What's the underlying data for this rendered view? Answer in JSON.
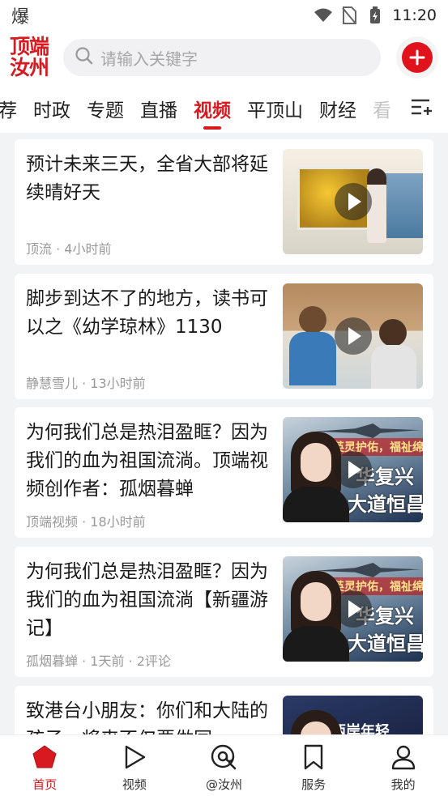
{
  "status_bar": {
    "left_text": "爆",
    "time": "11:20",
    "icons": [
      "wifi-icon",
      "no-sim-icon",
      "battery-charging-icon"
    ]
  },
  "header": {
    "logo_line1": "顶端",
    "logo_line2": "汝州",
    "search_placeholder": "请输入关键字",
    "add_icon": "plus-icon"
  },
  "tabs": {
    "items": [
      "荐",
      "时政",
      "专题",
      "直播",
      "视频",
      "平顶山",
      "财经",
      "看"
    ],
    "active": "视频",
    "menu_icon": "channel-menu-icon"
  },
  "feed": [
    {
      "title": "预计未来三天，全省大部将延续晴好天",
      "meta": "顶流 · 4小时前",
      "thumb": "weather-forecast-thumbnail"
    },
    {
      "title": "脚步到达不了的地方，读书可以之《幼学琼林》1130",
      "meta": "静慧雪儿 · 13小时前",
      "thumb": "children-reading-thumbnail"
    },
    {
      "title": "为何我们总是热泪盈眶？因为我们的血为祖国流淌。顶端视频创作者：孤烟暮蝉",
      "meta": "顶端视频 · 18小时前",
      "thumb": "host-thumbnail",
      "thumb_text": {
        "banner": "英灵护佑，福祉绵",
        "line1": "华复兴",
        "line2": "大道恒昌"
      }
    },
    {
      "title": "为何我们总是热泪盈眶？因为我们的血为祖国流淌【新疆游记】",
      "meta": "孤烟暮蝉 · 1天前 · 2评论",
      "thumb": "host-thumbnail",
      "thumb_text": {
        "banner": "英灵护佑，福祉绵",
        "line1": "华复兴",
        "line2": "大道恒昌"
      }
    },
    {
      "title": "致港台小朋友：你们和大陆的孩子一将来不仅要做同",
      "meta": "",
      "thumb": "host-thumbnail",
      "thumb_text": {
        "banner": "两岸年轻",
        "line1": "",
        "line2": ""
      }
    }
  ],
  "bottom_nav": [
    {
      "label": "首页",
      "icon": "home-icon",
      "active": true
    },
    {
      "label": "视频",
      "icon": "video-play-icon",
      "active": false
    },
    {
      "label": "@汝州",
      "icon": "at-location-icon",
      "active": false
    },
    {
      "label": "服务",
      "icon": "bookmark-icon",
      "active": false
    },
    {
      "label": "我的",
      "icon": "profile-icon",
      "active": false
    }
  ],
  "colors": {
    "brand_red": "#d71920",
    "background": "#f2f3f5",
    "meta_gray": "#999999"
  }
}
